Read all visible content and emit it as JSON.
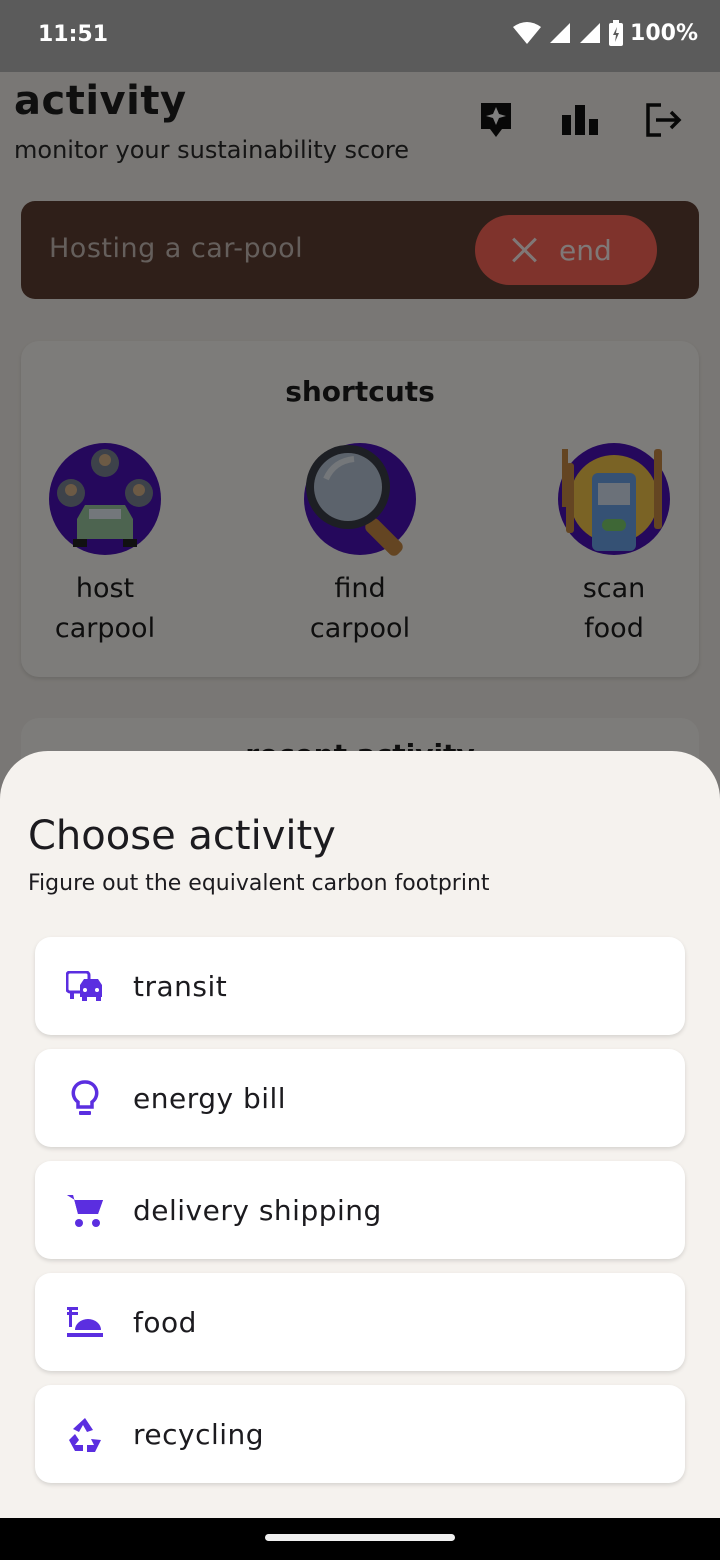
{
  "status_bar": {
    "time": "11:51",
    "battery": "100%"
  },
  "app": {
    "title": "activity",
    "subtitle": "monitor your sustainability score",
    "header_icons": [
      "sparkle-card-icon",
      "bar-chart-icon",
      "logout-icon"
    ]
  },
  "banner": {
    "text": "Hosting a car-pool",
    "end_label": "end"
  },
  "shortcuts": {
    "title": "shortcuts",
    "items": [
      {
        "line1": "host",
        "line2": "carpool"
      },
      {
        "line1": "find",
        "line2": "carpool"
      },
      {
        "line1": "scan",
        "line2": "food"
      }
    ]
  },
  "recent": {
    "title": "recent activity"
  },
  "sheet": {
    "title": "Choose activity",
    "subtitle": "Figure out the equivalent carbon footprint",
    "options": [
      {
        "label": "transit",
        "icon": "transit-icon"
      },
      {
        "label": "energy bill",
        "icon": "lightbulb-icon"
      },
      {
        "label": "delivery shipping",
        "icon": "cart-icon"
      },
      {
        "label": "food",
        "icon": "food-icon"
      },
      {
        "label": "recycling",
        "icon": "recycling-icon"
      }
    ]
  },
  "colors": {
    "accent": "#5b2ee0",
    "end_button": "#ff6659",
    "banner": "#5f3e33"
  }
}
